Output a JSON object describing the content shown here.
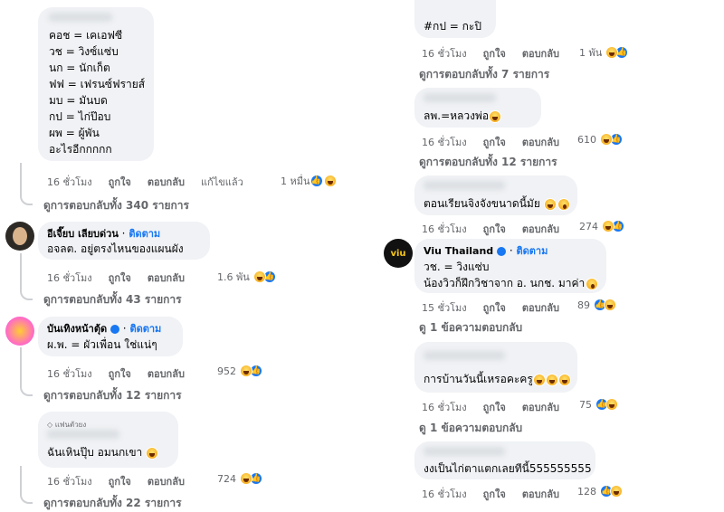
{
  "left": {
    "c1": {
      "lines": [
        "คอช = เคเอฟซี",
        "วช = วิงซ์แซ่บ",
        "นก = นักเก็ต",
        "ฟฟ = เฟรนซ์ฟรายส์",
        "มบ = มันบด",
        "กป = ไก่ป๊อบ",
        "ผพ = ผู้พัน",
        "อะไรอีกกกกก"
      ],
      "time": "16 ชั่วโมง",
      "like": "ถูกใจ",
      "reply": "ตอบกลับ",
      "edited": "แก้ไขแล้ว",
      "count": "1 หมื่น",
      "replies": "ดูการตอบกลับทั้ง 340 รายการ"
    },
    "c2": {
      "name": "อีเจี๊ยบ เลียบด่วน",
      "follow": "ติดตาม",
      "dot": "·",
      "text": "อจลต. อยู่ตรงไหนของแผนผัง",
      "time": "16 ชั่วโมง",
      "like": "ถูกใจ",
      "reply": "ตอบกลับ",
      "count": "1.6 พัน",
      "replies": "ดูการตอบกลับทั้ง 43 รายการ"
    },
    "c3": {
      "name": "บันเทิงหน้าตุ้ด",
      "follow": "ติดตาม",
      "dot": "·",
      "text": "ผ.พ. = ผัวเพื่อน ใช่แน่ๆ",
      "time": "16 ชั่วโมง",
      "like": "ถูกใจ",
      "reply": "ตอบกลับ",
      "count": "952",
      "replies": "ดูการตอบกลับทั้ง 12 รายการ"
    },
    "c4": {
      "badge": "แฟนตัวยง",
      "text": "ฉันเหินปุ๊บ อมนกเขา",
      "time": "16 ชั่วโมง",
      "like": "ถูกใจ",
      "reply": "ตอบกลับ",
      "count": "724",
      "replies": "ดูการตอบกลับทั้ง 22 รายการ"
    }
  },
  "right": {
    "c1": {
      "text": "#กป = กะปิ",
      "time": "16 ชั่วโมง",
      "like": "ถูกใจ",
      "reply": "ตอบกลับ",
      "count": "1 พัน",
      "replies": "ดูการตอบกลับทั้ง 7 รายการ"
    },
    "c2": {
      "text": "ลพ.=หลวงพ่อ",
      "time": "16 ชั่วโมง",
      "like": "ถูกใจ",
      "reply": "ตอบกลับ",
      "count": "610",
      "replies": "ดูการตอบกลับทั้ง 12 รายการ"
    },
    "c3": {
      "text": "ตอนเรียนจิงจังขนาดนี้มัย",
      "time": "16 ชั่วโมง",
      "like": "ถูกใจ",
      "reply": "ตอบกลับ",
      "count": "274"
    },
    "c4": {
      "name": "Viu Thailand",
      "follow": "ติดตาม",
      "dot": "·",
      "avatar_text": "viu",
      "line1": "วช. = วิงแซ่บ",
      "line2": "น้องวิวก็ฝึกวิชาจาก อ. นกช. มาค่า",
      "time": "15 ชั่วโมง",
      "like": "ถูกใจ",
      "reply": "ตอบกลับ",
      "count": "89",
      "replies": "ดู 1 ข้อความตอบกลับ"
    },
    "c5": {
      "text": "การบ้านวันนี้เหรอคะครู",
      "time": "16 ชั่วโมง",
      "like": "ถูกใจ",
      "reply": "ตอบกลับ",
      "count": "75",
      "replies": "ดู 1 ข้อความตอบกลับ"
    },
    "c6": {
      "text": "งงเป็นไก่ตาแตกเลยทีนี้555555555",
      "time": "16 ชั่วโมง",
      "like": "ถูกใจ",
      "reply": "ตอบกลับ",
      "count": "128"
    }
  },
  "colors": {
    "bubble": "#f0f2f5",
    "meta": "#65676b",
    "link": "#1877f2"
  }
}
